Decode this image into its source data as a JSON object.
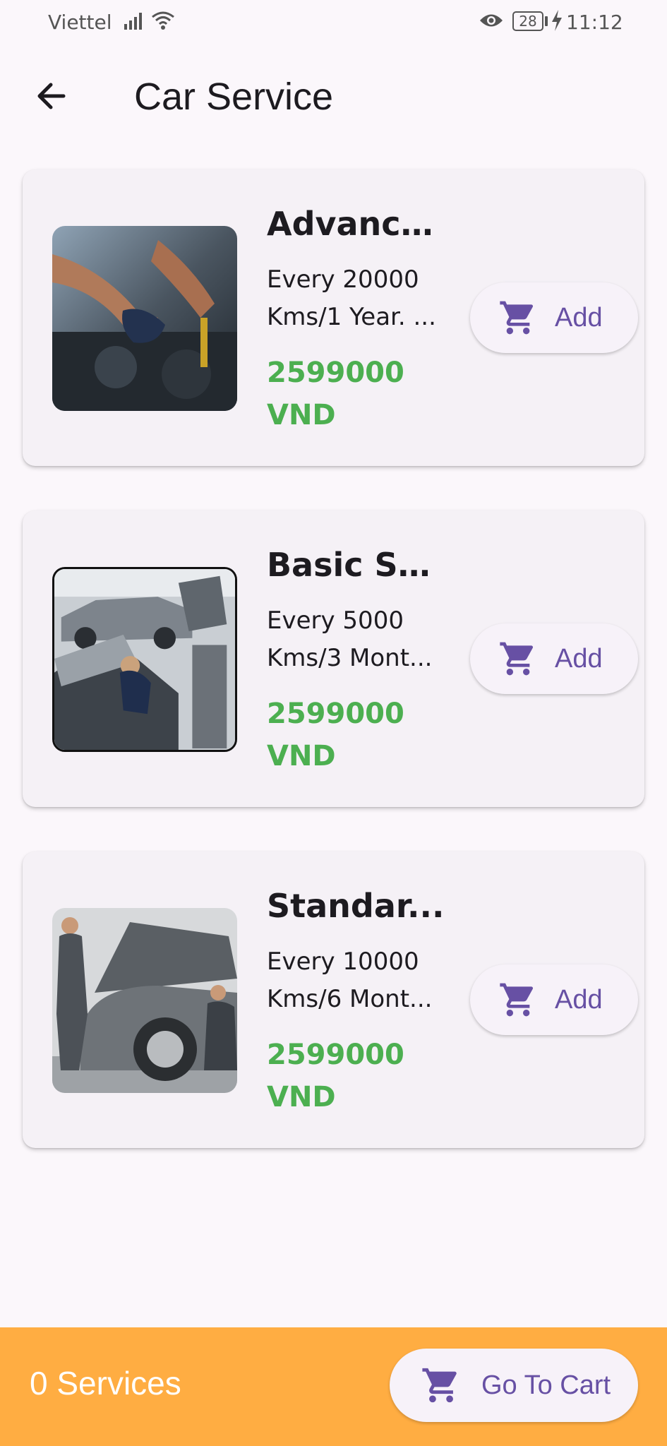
{
  "status_bar": {
    "carrier": "Viettel",
    "battery": "28",
    "time": "11:12"
  },
  "header": {
    "title": "Car Service"
  },
  "services": [
    {
      "title": "Advance...",
      "desc_line1": "Every 20000",
      "desc_line2": "Kms/1 Year. ...",
      "price_line1": "2599000",
      "price_line2": "VND",
      "add_label": "Add"
    },
    {
      "title": "Basic Se...",
      "desc_line1": "Every 5000",
      "desc_line2": "Kms/3 Mont...",
      "price_line1": "2599000",
      "price_line2": "VND",
      "add_label": "Add"
    },
    {
      "title": "Standar...",
      "desc_line1": "Every 10000",
      "desc_line2": "Kms/6 Mont...",
      "price_line1": "2599000",
      "price_line2": "VND",
      "add_label": "Add"
    }
  ],
  "footer": {
    "service_count": "0 Services",
    "cart_label": "Go To Cart"
  },
  "colors": {
    "accent": "#6750a4",
    "price": "#4caf50",
    "bottom_bar": "#ffad42"
  }
}
